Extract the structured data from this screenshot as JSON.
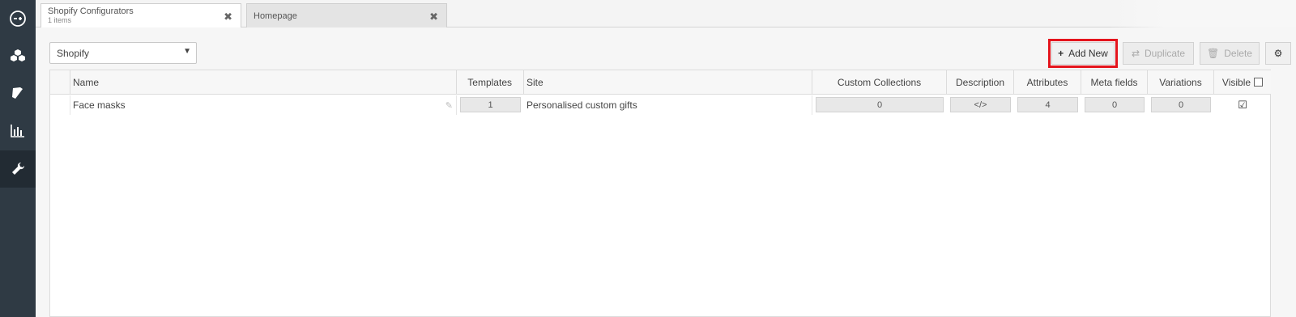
{
  "sidebar": {
    "items": [
      {
        "icon": "logo-icon"
      },
      {
        "icon": "cubes-icon"
      },
      {
        "icon": "book-icon"
      },
      {
        "icon": "bar-chart-icon"
      },
      {
        "icon": "wrench-icon",
        "active": true
      }
    ]
  },
  "tabs": [
    {
      "title": "Shopify Configurators",
      "subtitle": "1 items",
      "close": "✖"
    },
    {
      "title": "Homepage",
      "close": "✖"
    }
  ],
  "toolbar": {
    "store_select": "Shopify",
    "add_new": "Add New",
    "duplicate": "Duplicate",
    "delete": "Delete",
    "settings_icon": "gear-icon"
  },
  "table": {
    "columns": {
      "name": "Name",
      "templates": "Templates",
      "site": "Site",
      "custom_collections": "Custom Collections",
      "description": "Description",
      "attributes": "Attributes",
      "meta_fields": "Meta fields",
      "variations": "Variations",
      "visible": "Visible"
    },
    "rows": [
      {
        "name": "Face masks",
        "templates": "1",
        "site": "Personalised custom gifts",
        "custom_collections": "0",
        "description": "</>",
        "attributes": "4",
        "meta_fields": "0",
        "variations": "0",
        "visible": "☑"
      }
    ]
  },
  "colors": {
    "sidebar": "#2f3a44",
    "highlight": "#e4141c"
  }
}
